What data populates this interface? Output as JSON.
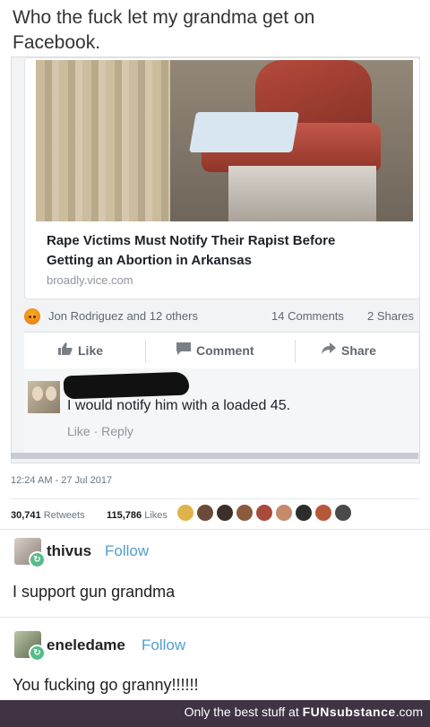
{
  "caption": {
    "line1": "Who the fuck let my grandma get on",
    "line2": "Facebook."
  },
  "facebook_post": {
    "link_preview": {
      "headline_line1": "Rape Victims Must Notify Their Rapist Before",
      "headline_line2": "Getting an Abortion in Arkansas",
      "source": "broadly.vice.com"
    },
    "reactions": {
      "icon": "angry-reaction-icon",
      "names": "Jon Rodriguez and 12 others",
      "comments": "14 Comments",
      "shares": "2 Shares"
    },
    "actions": {
      "like": "Like",
      "comment": "Comment",
      "share": "Share"
    },
    "comment": {
      "text": "I would notify him with a loaded 45.",
      "like": "Like",
      "separator": "·",
      "reply": "Reply"
    }
  },
  "tweet_meta": {
    "timestamp": "12:24 AM - 27 Jul 2017",
    "retweets_count": "30,741",
    "retweets_label": "Retweets",
    "likes_count": "115,786",
    "likes_label": "Likes",
    "liker_colors": [
      "#e0b24a",
      "#6b4a3a",
      "#3c2f2a",
      "#8a5a3c",
      "#a84b3a",
      "#c58a6a",
      "#2d2d2d",
      "#b5583a",
      "#4a4a4a"
    ]
  },
  "replies": [
    {
      "username": "thivus",
      "follow": "Follow",
      "text": "I support gun grandma"
    },
    {
      "username": "eneledame",
      "follow": "Follow",
      "text": "You fucking go granny!!!!!!"
    }
  ],
  "footer": {
    "prefix": "Only the best stuff at ",
    "brand": "FUNsubstance",
    "suffix": ".com"
  },
  "colors": {
    "follow_blue": "#529ecc",
    "reblog_green": "#56bc8a",
    "footer_bg": "#3f3344"
  }
}
